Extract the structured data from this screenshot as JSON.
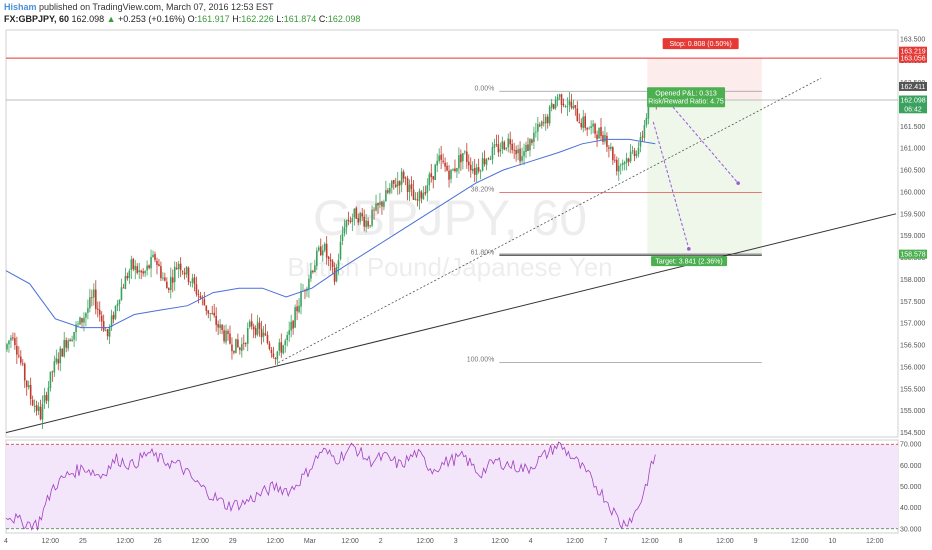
{
  "header": {
    "author": "Hisham",
    "published_text": "published on TradingView.com, March 07, 2016 12:53 EST",
    "symbol": "FX:GBPJPY, 60",
    "last": "162.098",
    "change": "+0.253 (+0.16%)",
    "o_label": "O:",
    "o_value": "161.917",
    "h_label": "H:",
    "h_value": "162.226",
    "l_label": "L:",
    "l_value": "161.874",
    "c_label": "C:",
    "c_value": "162.098"
  },
  "watermark": {
    "symbol": "GBPJPY, 60",
    "name": "British Pound/Japanese Yen"
  },
  "colors": {
    "up": "#3aa15e",
    "down": "#c0392b",
    "ma": "#4a6fd9",
    "stop": "#e53935",
    "target": "#4caf50",
    "rsi_line": "#a040c0",
    "rsi_band": "#f3e6fb",
    "risk_zone": "#fdecec",
    "reward_zone": "#eef7ea"
  },
  "labels": {
    "stop": "Stop: 0.808 (0.50%)",
    "opened": "Opened P&L: 0.313",
    "risk_reward": "Risk/Reward Ratio: 4.75",
    "target": "Target: 3.841 (2.36%)",
    "fib_0": "0.00%",
    "fib_382": "38.20%",
    "fib_618": "61.80%",
    "fib_100": "100.00%"
  },
  "price_badges": {
    "stop": "163.219",
    "stop2": "163.056",
    "high": "162.411",
    "last": "162.098",
    "countdown": "06:42",
    "target": "158.578"
  },
  "price_axis": [
    "163.500",
    "163.000",
    "162.500",
    "162.000",
    "161.500",
    "161.000",
    "160.500",
    "160.000",
    "159.500",
    "159.000",
    "158.500",
    "158.000",
    "157.500",
    "157.000",
    "156.500",
    "156.000",
    "155.500",
    "155.000",
    "154.500"
  ],
  "rsi_axis": [
    "70.000",
    "60.000",
    "50.000",
    "40.000",
    "30.000"
  ],
  "time_axis": [
    "4",
    "12:00",
    "25",
    "12:00",
    "26",
    "12:00",
    "29",
    "12:00",
    "Mar",
    "12:00",
    "2",
    "12:00",
    "3",
    "12:00",
    "4",
    "12:00",
    "7",
    "12:00",
    "8",
    "12:00",
    "9",
    "12:00",
    "10",
    "12:00"
  ],
  "chart_data": {
    "type": "candlestick",
    "symbol": "FX:GBPJPY",
    "interval": "60",
    "y_range": [
      154.4,
      163.7
    ],
    "rsi_range": [
      28,
      72
    ],
    "rsi_levels": [
      30,
      70
    ],
    "key_points": [
      {
        "t": 0,
        "p": 156.4
      },
      {
        "t": 4,
        "p": 156.8
      },
      {
        "t": 9,
        "p": 155.9
      },
      {
        "t": 13,
        "p": 155.3
      },
      {
        "t": 18,
        "p": 154.9
      },
      {
        "t": 24,
        "p": 155.9
      },
      {
        "t": 31,
        "p": 156.6
      },
      {
        "t": 38,
        "p": 157.0
      },
      {
        "t": 45,
        "p": 157.6
      },
      {
        "t": 52,
        "p": 156.7
      },
      {
        "t": 58,
        "p": 157.7
      },
      {
        "t": 64,
        "p": 158.3
      },
      {
        "t": 70,
        "p": 158.1
      },
      {
        "t": 76,
        "p": 158.5
      },
      {
        "t": 82,
        "p": 157.8
      },
      {
        "t": 88,
        "p": 158.4
      },
      {
        "t": 94,
        "p": 158.0
      },
      {
        "t": 100,
        "p": 157.5
      },
      {
        "t": 107,
        "p": 157.0
      },
      {
        "t": 113,
        "p": 156.6
      },
      {
        "t": 119,
        "p": 156.4
      },
      {
        "t": 125,
        "p": 157.0
      },
      {
        "t": 131,
        "p": 156.7
      },
      {
        "t": 137,
        "p": 156.3
      },
      {
        "t": 143,
        "p": 156.6
      },
      {
        "t": 149,
        "p": 157.5
      },
      {
        "t": 155,
        "p": 158.2
      },
      {
        "t": 161,
        "p": 158.8
      },
      {
        "t": 167,
        "p": 158.0
      },
      {
        "t": 172,
        "p": 159.3
      },
      {
        "t": 178,
        "p": 159.5
      },
      {
        "t": 184,
        "p": 159.3
      },
      {
        "t": 190,
        "p": 159.7
      },
      {
        "t": 196,
        "p": 160.1
      },
      {
        "t": 202,
        "p": 160.4
      },
      {
        "t": 208,
        "p": 159.7
      },
      {
        "t": 214,
        "p": 160.2
      },
      {
        "t": 220,
        "p": 160.7
      },
      {
        "t": 226,
        "p": 160.4
      },
      {
        "t": 232,
        "p": 160.9
      },
      {
        "t": 238,
        "p": 160.5
      },
      {
        "t": 244,
        "p": 160.8
      },
      {
        "t": 250,
        "p": 161.0
      },
      {
        "t": 256,
        "p": 161.2
      },
      {
        "t": 262,
        "p": 160.8
      },
      {
        "t": 268,
        "p": 161.3
      },
      {
        "t": 274,
        "p": 161.6
      },
      {
        "t": 280,
        "p": 162.2
      },
      {
        "t": 286,
        "p": 162.0
      },
      {
        "t": 292,
        "p": 161.6
      },
      {
        "t": 298,
        "p": 161.4
      },
      {
        "t": 304,
        "p": 161.3
      },
      {
        "t": 310,
        "p": 160.6
      },
      {
        "t": 316,
        "p": 160.8
      },
      {
        "t": 322,
        "p": 161.1
      },
      {
        "t": 326,
        "p": 162.0
      },
      {
        "t": 329,
        "p": 162.1
      }
    ],
    "ma_points": [
      {
        "t": 0,
        "p": 158.2
      },
      {
        "t": 12,
        "p": 157.9
      },
      {
        "t": 25,
        "p": 157.1
      },
      {
        "t": 38,
        "p": 156.9
      },
      {
        "t": 52,
        "p": 156.9
      },
      {
        "t": 65,
        "p": 157.2
      },
      {
        "t": 78,
        "p": 157.3
      },
      {
        "t": 92,
        "p": 157.4
      },
      {
        "t": 105,
        "p": 157.7
      },
      {
        "t": 118,
        "p": 157.8
      },
      {
        "t": 130,
        "p": 157.8
      },
      {
        "t": 142,
        "p": 157.6
      },
      {
        "t": 155,
        "p": 157.8
      },
      {
        "t": 168,
        "p": 158.2
      },
      {
        "t": 182,
        "p": 158.6
      },
      {
        "t": 196,
        "p": 159.0
      },
      {
        "t": 210,
        "p": 159.4
      },
      {
        "t": 224,
        "p": 159.8
      },
      {
        "t": 238,
        "p": 160.2
      },
      {
        "t": 252,
        "p": 160.5
      },
      {
        "t": 266,
        "p": 160.7
      },
      {
        "t": 280,
        "p": 160.9
      },
      {
        "t": 292,
        "p": 161.1
      },
      {
        "t": 304,
        "p": 161.2
      },
      {
        "t": 316,
        "p": 161.2
      },
      {
        "t": 329,
        "p": 161.1
      }
    ],
    "rsi_points": [
      {
        "t": 0,
        "p": 37
      },
      {
        "t": 8,
        "p": 33
      },
      {
        "t": 16,
        "p": 32
      },
      {
        "t": 24,
        "p": 50
      },
      {
        "t": 32,
        "p": 56
      },
      {
        "t": 40,
        "p": 59
      },
      {
        "t": 48,
        "p": 55
      },
      {
        "t": 56,
        "p": 63
      },
      {
        "t": 64,
        "p": 60
      },
      {
        "t": 72,
        "p": 66
      },
      {
        "t": 80,
        "p": 62
      },
      {
        "t": 88,
        "p": 60
      },
      {
        "t": 96,
        "p": 52
      },
      {
        "t": 104,
        "p": 46
      },
      {
        "t": 112,
        "p": 41
      },
      {
        "t": 120,
        "p": 42
      },
      {
        "t": 128,
        "p": 46
      },
      {
        "t": 136,
        "p": 50
      },
      {
        "t": 144,
        "p": 48
      },
      {
        "t": 152,
        "p": 56
      },
      {
        "t": 160,
        "p": 67
      },
      {
        "t": 168,
        "p": 63
      },
      {
        "t": 176,
        "p": 69
      },
      {
        "t": 184,
        "p": 62
      },
      {
        "t": 192,
        "p": 64
      },
      {
        "t": 200,
        "p": 60
      },
      {
        "t": 208,
        "p": 66
      },
      {
        "t": 216,
        "p": 58
      },
      {
        "t": 224,
        "p": 62
      },
      {
        "t": 232,
        "p": 64
      },
      {
        "t": 240,
        "p": 56
      },
      {
        "t": 248,
        "p": 62
      },
      {
        "t": 256,
        "p": 60
      },
      {
        "t": 264,
        "p": 58
      },
      {
        "t": 272,
        "p": 64
      },
      {
        "t": 280,
        "p": 70
      },
      {
        "t": 288,
        "p": 63
      },
      {
        "t": 296,
        "p": 54
      },
      {
        "t": 304,
        "p": 44
      },
      {
        "t": 312,
        "p": 32
      },
      {
        "t": 318,
        "p": 36
      },
      {
        "t": 322,
        "p": 44
      },
      {
        "t": 329,
        "p": 65
      }
    ],
    "drawings": {
      "support_line": {
        "t1": 0,
        "p1": 154.5,
        "t2": 451,
        "p2": 159.5
      },
      "dotted_trend": {
        "t1": 138,
        "p1": 156.1,
        "t2": 413,
        "p2": 162.6
      },
      "fib_levels": {
        "0": 162.3,
        "38.2": 159.99,
        "61.8": 158.55,
        "100": 156.1
      },
      "stop_price": 163.056,
      "target_price": 158.578,
      "position_start_t": 325,
      "position_end_t": 383
    }
  }
}
